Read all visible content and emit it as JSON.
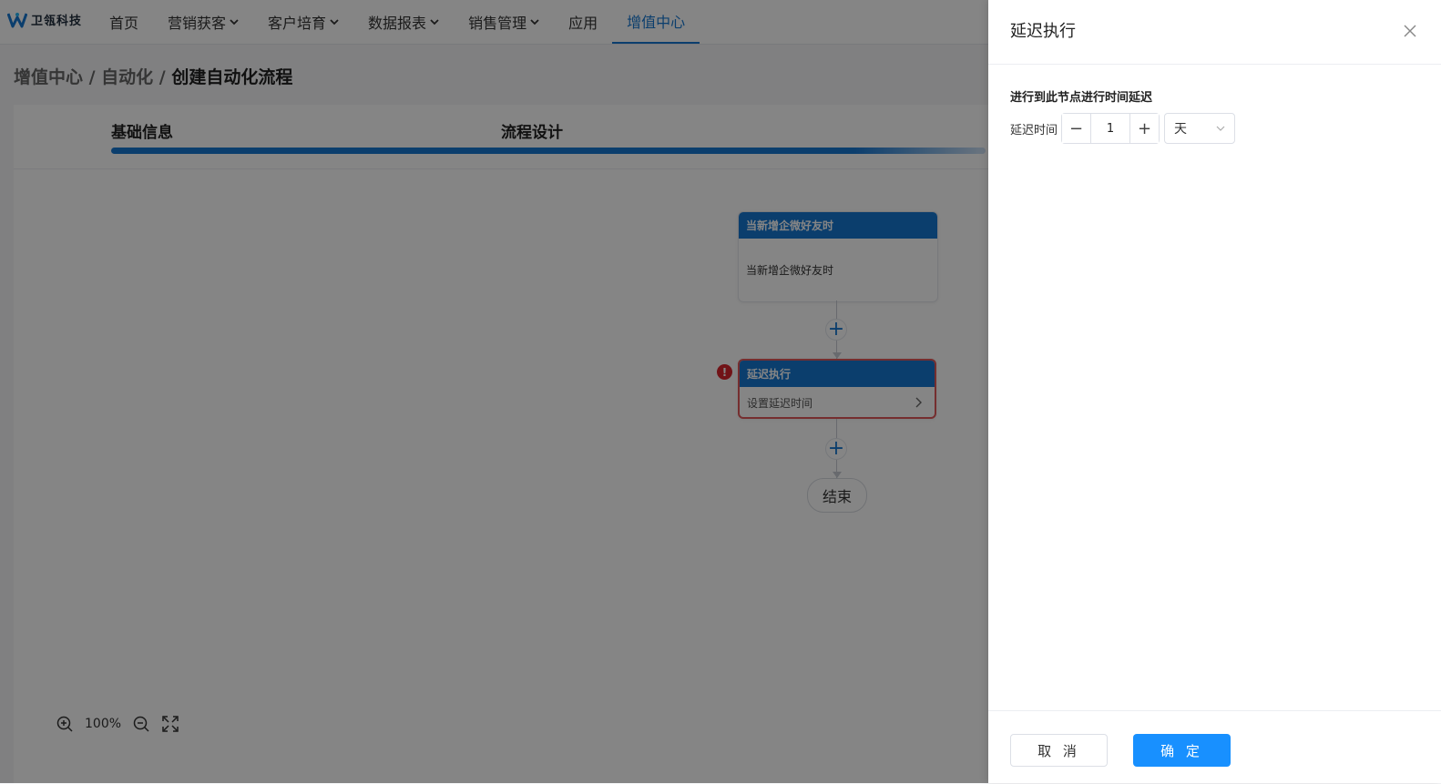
{
  "brand": {
    "name": "卫瓴科技"
  },
  "nav": {
    "items": [
      {
        "label": "首页",
        "has_dropdown": false,
        "active": false
      },
      {
        "label": "营销获客",
        "has_dropdown": true,
        "active": false
      },
      {
        "label": "客户培育",
        "has_dropdown": true,
        "active": false
      },
      {
        "label": "数据报表",
        "has_dropdown": true,
        "active": false
      },
      {
        "label": "销售管理",
        "has_dropdown": true,
        "active": false
      },
      {
        "label": "应用",
        "has_dropdown": false,
        "active": false
      },
      {
        "label": "增值中心",
        "has_dropdown": false,
        "active": true
      }
    ]
  },
  "breadcrumb": {
    "part1": "增值中心 / ",
    "part2": "自动化 / ",
    "current": "创建自动化流程"
  },
  "steps": {
    "step1": "基础信息",
    "step2": "流程设计"
  },
  "flow": {
    "trigger": {
      "title": "当新增企微好友时",
      "body": "当新增企微好友时"
    },
    "delay": {
      "title": "延迟执行",
      "body": "设置延迟时间",
      "warning": "!"
    },
    "end": "结束"
  },
  "zoom": {
    "level": "100%"
  },
  "drawer": {
    "title": "延迟执行",
    "section_title": "进行到此节点进行时间延迟",
    "field_label": "延迟时间",
    "stepper": {
      "minus": "−",
      "value": "1",
      "plus": "+"
    },
    "unit": "天",
    "cancel": "取 消",
    "confirm": "确 定"
  },
  "colors": {
    "accent": "#1677d2",
    "primary_button": "#1890ff",
    "error": "#d8262c"
  }
}
